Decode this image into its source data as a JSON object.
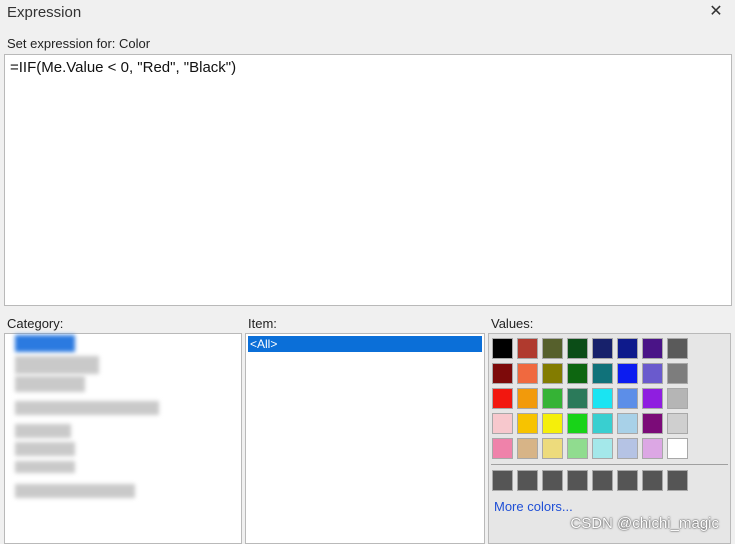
{
  "window": {
    "title": "Expression",
    "close_glyph": "✕"
  },
  "expression": {
    "label": "Set expression for: Color",
    "value": "=IIF(Me.Value < 0, \"Red\", \"Black\")"
  },
  "category": {
    "label": "Category:"
  },
  "item": {
    "label": "Item:",
    "selected": "<All>"
  },
  "values": {
    "label": "Values:",
    "more_colors": "More colors...",
    "palette_rows": [
      [
        "#000000",
        "#b03a2e",
        "#56602c",
        "#0b4d17",
        "#17216b",
        "#0e1a8c",
        "#4a1487",
        "#5a5a5a"
      ],
      [
        "#7d0a0a",
        "#f0693f",
        "#837c00",
        "#0d6610",
        "#10727a",
        "#0c1cf0",
        "#6a5acd",
        "#7d7d7d"
      ],
      [
        "#f2170f",
        "#f29a0b",
        "#35b335",
        "#2b7a5a",
        "#1ae4f2",
        "#5c8ee8",
        "#8f1ee0",
        "#b5b5b5"
      ],
      [
        "#f7c8cd",
        "#f7c300",
        "#f5ef0a",
        "#18d318",
        "#39cfd0",
        "#a8d1e8",
        "#7b0b78",
        "#cfcfcf"
      ],
      [
        "#ef82aa",
        "#d7b487",
        "#eddb7c",
        "#90dc8f",
        "#a4e8ea",
        "#b5c3e4",
        "#dca7e4",
        "#ffffff"
      ]
    ],
    "custom_row": [
      "#555555",
      "#555555",
      "#555555",
      "#555555",
      "#555555",
      "#555555",
      "#555555",
      "#555555"
    ]
  },
  "watermark": "CSDN @chichi_magic"
}
